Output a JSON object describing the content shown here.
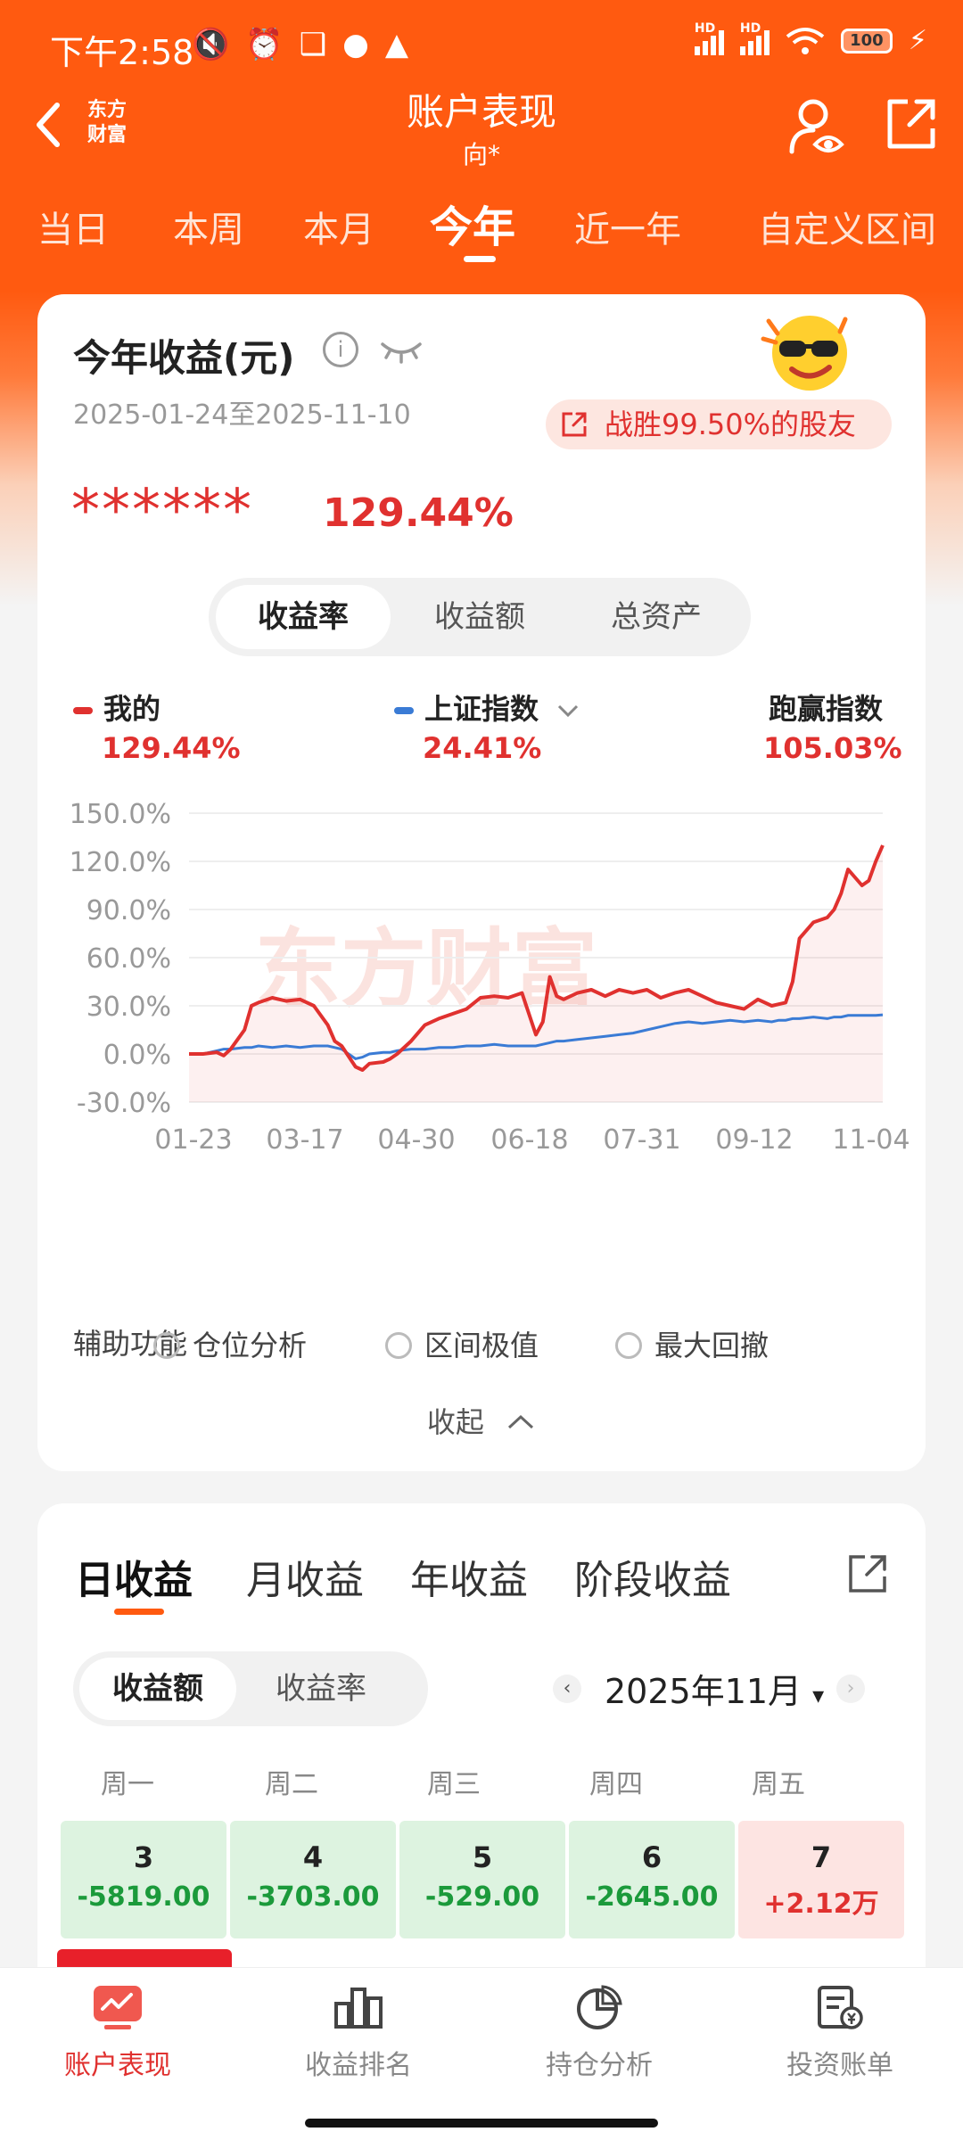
{
  "status_bar": {
    "time": "下午2:58",
    "battery": "100",
    "hd1": "HD",
    "hd2": "HD"
  },
  "header": {
    "logo_line1": "东方",
    "logo_line2": "财富",
    "title": "账户表现",
    "subtitle": "向*"
  },
  "period_tabs": [
    {
      "label": "当日",
      "active": false
    },
    {
      "label": "本周",
      "active": false
    },
    {
      "label": "本月",
      "active": false
    },
    {
      "label": "今年",
      "active": true
    },
    {
      "label": "近一年",
      "active": false
    },
    {
      "label": "自定义区间",
      "active": false
    }
  ],
  "summary": {
    "title": "今年收益(元)",
    "info_icon": "i",
    "date_range": "2025-01-24至2025-11-10",
    "beat_text": "战胜99.50%的股友",
    "masked_amount": "******",
    "return_pct": "129.44%"
  },
  "metric_tabs": [
    {
      "label": "收益率",
      "active": true
    },
    {
      "label": "收益额",
      "active": false
    },
    {
      "label": "总资产",
      "active": false
    }
  ],
  "legend": {
    "mine_label": "我的",
    "mine_value": "129.44%",
    "mine_color": "#e0312f",
    "index_label": "上证指数",
    "index_value": "24.41%",
    "index_color": "#3a7bd5",
    "outperform_label": "跑赢指数",
    "outperform_value": "105.03%"
  },
  "watermark": "东方财富",
  "chart_data": {
    "type": "line",
    "x_ticks": [
      "01-23",
      "03-17",
      "04-30",
      "06-18",
      "07-31",
      "09-12",
      "11-04"
    ],
    "y_ticks": [
      "150.0%",
      "120.0%",
      "90.0%",
      "60.0%",
      "30.0%",
      "0.0%",
      "-30.0%"
    ],
    "ylim": [
      -30,
      150
    ],
    "x": [
      0,
      0.02,
      0.04,
      0.05,
      0.06,
      0.08,
      0.09,
      0.1,
      0.12,
      0.14,
      0.16,
      0.18,
      0.2,
      0.21,
      0.22,
      0.24,
      0.25,
      0.26,
      0.28,
      0.29,
      0.3,
      0.32,
      0.34,
      0.36,
      0.38,
      0.4,
      0.42,
      0.44,
      0.46,
      0.48,
      0.5,
      0.51,
      0.52,
      0.53,
      0.54,
      0.56,
      0.58,
      0.6,
      0.62,
      0.64,
      0.66,
      0.68,
      0.7,
      0.72,
      0.74,
      0.76,
      0.78,
      0.8,
      0.82,
      0.84,
      0.85,
      0.86,
      0.87,
      0.88,
      0.9,
      0.92,
      0.93,
      0.94,
      0.95,
      0.96,
      0.97,
      0.98,
      0.99,
      1.0
    ],
    "series": [
      {
        "name": "我的",
        "color": "#e0312f",
        "values": [
          0,
          0,
          1,
          -1,
          3,
          15,
          30,
          32,
          35,
          33,
          34,
          30,
          18,
          8,
          5,
          -8,
          -10,
          -6,
          -5,
          -3,
          0,
          8,
          18,
          22,
          25,
          28,
          35,
          36,
          35,
          38,
          12,
          20,
          48,
          36,
          34,
          38,
          40,
          36,
          40,
          38,
          40,
          35,
          38,
          40,
          36,
          32,
          30,
          28,
          34,
          30,
          31,
          32,
          45,
          72,
          82,
          85,
          90,
          100,
          115,
          110,
          105,
          108,
          120,
          130
        ]
      },
      {
        "name": "上证指数",
        "color": "#3a7bd5",
        "values": [
          0,
          0,
          2,
          3,
          3,
          4,
          4,
          5,
          4,
          5,
          4,
          5,
          5,
          4,
          3,
          -3,
          -2,
          0,
          1,
          1,
          2,
          3,
          3,
          4,
          4,
          5,
          5,
          6,
          5,
          5,
          5,
          6,
          7,
          8,
          8,
          9,
          10,
          11,
          12,
          13,
          15,
          17,
          19,
          20,
          19,
          20,
          21,
          20,
          21,
          20,
          21,
          21,
          22,
          22,
          23,
          22,
          23,
          23,
          24,
          24,
          24,
          24,
          24,
          24.41
        ]
      }
    ]
  },
  "assist": {
    "label": "辅助功能",
    "options": [
      "仓位分析",
      "区间极值",
      "最大回撤"
    ]
  },
  "collapse_label": "收起",
  "earnings_tabs": [
    {
      "label": "日收益",
      "active": true
    },
    {
      "label": "月收益",
      "active": false
    },
    {
      "label": "年收益",
      "active": false
    },
    {
      "label": "阶段收益",
      "active": false
    }
  ],
  "earnings_metric": [
    {
      "label": "收益额",
      "active": true
    },
    {
      "label": "收益率",
      "active": false
    }
  ],
  "month": "2025年11月",
  "weekdays": [
    "周一",
    "周二",
    "周三",
    "周四",
    "周五"
  ],
  "days": [
    {
      "day": "3",
      "value": "-5819.00",
      "sign": "neg"
    },
    {
      "day": "4",
      "value": "-3703.00",
      "sign": "neg"
    },
    {
      "day": "5",
      "value": "-529.00",
      "sign": "neg"
    },
    {
      "day": "6",
      "value": "-2645.00",
      "sign": "neg"
    },
    {
      "day": "7",
      "value": "+2.12万",
      "sign": "pos"
    }
  ],
  "bottom_nav": [
    {
      "label": "账户表现",
      "icon": "chart-icon",
      "active": true
    },
    {
      "label": "收益排名",
      "icon": "bar-icon",
      "active": false
    },
    {
      "label": "持仓分析",
      "icon": "pie-icon",
      "active": false
    },
    {
      "label": "投资账单",
      "icon": "bill-icon",
      "active": false
    }
  ]
}
